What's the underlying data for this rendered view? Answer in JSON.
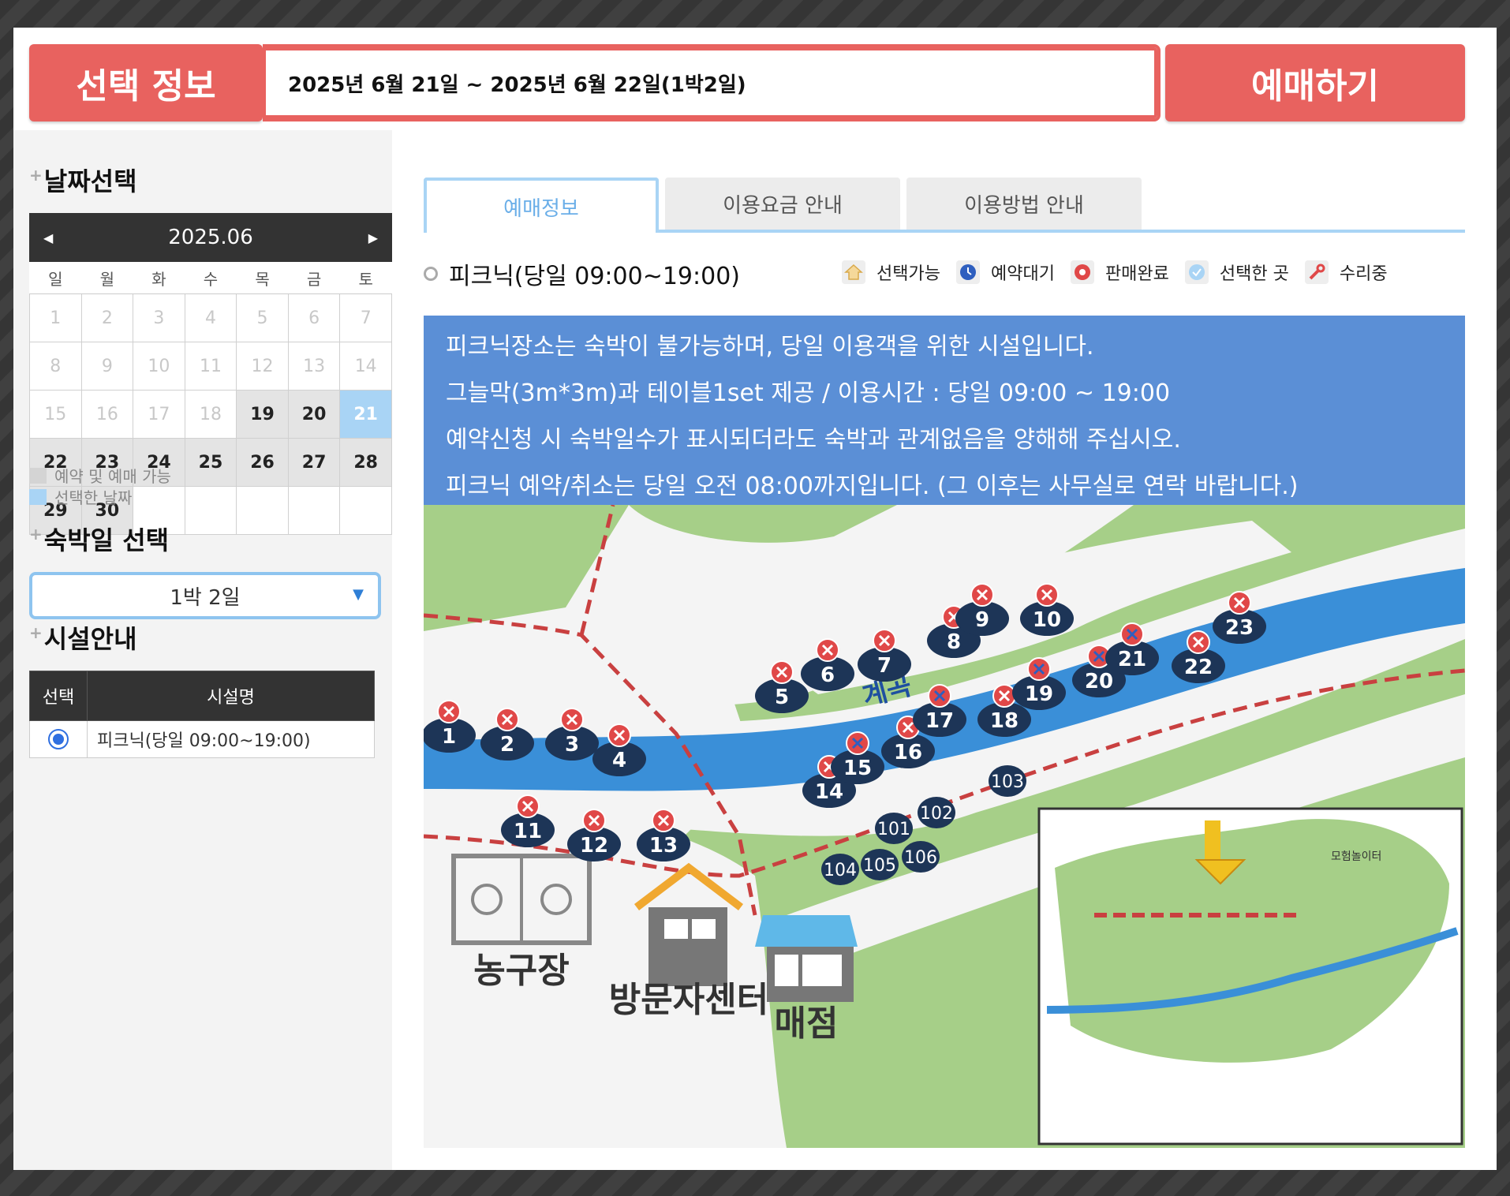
{
  "topbar": {
    "selection_label": "선택 정보",
    "selection_value": "2025년 6월 21일 ~ 2025년 6월 22일(1박2일)",
    "book_button": "예매하기"
  },
  "sidebar": {
    "date_title": "날짜선택",
    "calendar": {
      "month": "2025.06",
      "weekdays": [
        "일",
        "월",
        "화",
        "수",
        "목",
        "금",
        "토"
      ],
      "available_days": [
        19,
        20,
        22,
        23,
        24,
        25,
        26,
        27,
        28,
        29,
        30
      ],
      "selected_day": 21
    },
    "legend": {
      "available": "예약 및 예매 가능",
      "selected": "선택한 날짜"
    },
    "nights_title": "숙박일 선택",
    "nights_value": "1박 2일",
    "facility_title": "시설안내",
    "facility_table": {
      "col_select": "선택",
      "col_name": "시설명",
      "rows": [
        {
          "name": "피크닉(당일 09:00~19:00)",
          "selected": true
        }
      ]
    }
  },
  "main": {
    "tabs": [
      {
        "label": "예매정보",
        "active": true
      },
      {
        "label": "이용요금 안내",
        "active": false
      },
      {
        "label": "이용방법 안내",
        "active": false
      }
    ],
    "section_title": "피크닉(당일 09:00~19:00)",
    "status_legend": {
      "available": "선택가능",
      "waiting": "예약대기",
      "soldout": "판매완료",
      "selected": "선택한 곳",
      "repair": "수리중"
    },
    "notice_lines": [
      "피크닉장소는 숙박이 불가능하며, 당일 이용객을 위한 시설입니다.",
      "그늘막(3m*3m)과 테이블1set 제공 / 이용시간 : 당일 09:00 ~ 19:00",
      "예약신청 시 숙박일수가 표시되더라도 숙박과 관계없음을 양해해 주십시오.",
      "피크닉 예약/취소는 당일 오전 08:00까지입니다. (그 이후는 사무실로 연락 바랍니다.)"
    ],
    "map": {
      "stream_label": "계곡",
      "basketball_label": "농구장",
      "visitor_center_label": "방문자센터",
      "store_label": "매점",
      "other_sites": [
        "101",
        "102",
        "103",
        "104",
        "105",
        "106"
      ],
      "sold_out_sites": [
        "1",
        "2",
        "3",
        "4",
        "5",
        "6",
        "7",
        "8",
        "9",
        "10",
        "11",
        "12",
        "13",
        "14",
        "16",
        "18",
        "22",
        "23"
      ],
      "waiting_sites": [
        "15",
        "17",
        "19",
        "20",
        "21"
      ],
      "inset_labels": [
        "모험놀이터"
      ]
    }
  },
  "colors": {
    "accent_red": "#e8625f",
    "selected_blue": "#a9d4f5",
    "notice_blue": "#5b8fd6",
    "site_navy": "#1d3557"
  }
}
